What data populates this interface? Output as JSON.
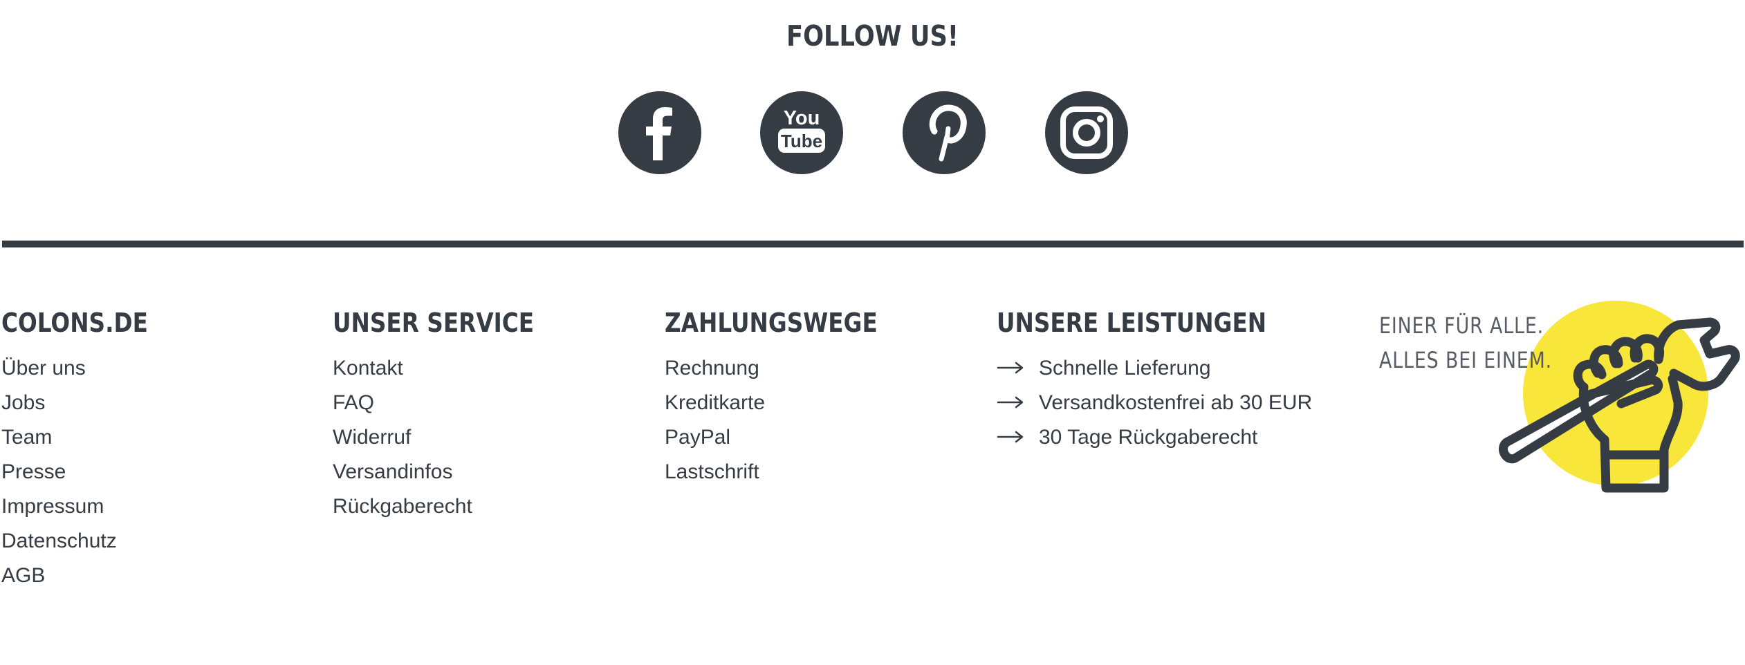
{
  "follow": {
    "title": "FOLLOW US!"
  },
  "social": [
    {
      "name": "Facebook",
      "icon": "facebook-icon"
    },
    {
      "name": "YouTube",
      "icon": "youtube-icon",
      "logo_text_top": "You",
      "logo_text_bottom": "Tube"
    },
    {
      "name": "Pinterest",
      "icon": "pinterest-icon"
    },
    {
      "name": "Instagram",
      "icon": "instagram-icon"
    }
  ],
  "footer": {
    "columns": [
      {
        "heading": "COLONS.DE",
        "items": [
          "Über uns",
          "Jobs",
          "Team",
          "Presse",
          "Impressum",
          "Datenschutz",
          "AGB"
        ]
      },
      {
        "heading": "UNSER SERVICE",
        "items": [
          "Kontakt",
          "FAQ",
          "Widerruf",
          "Versandinfos",
          "Rückgaberecht"
        ]
      },
      {
        "heading": "ZAHLUNGSWEGE",
        "items": [
          "Rechnung",
          "Kreditkarte",
          "PayPal",
          "Lastschrift"
        ]
      },
      {
        "heading": "UNSERE LEISTUNGEN",
        "items": [
          "Schnelle Lieferung",
          "Versandkostenfrei ab 30 EUR",
          "30 Tage Rückgaberecht"
        ],
        "bullet_icon": "arrow-right-icon"
      }
    ],
    "slogan": {
      "line1": "EINER FÜR ALLE.",
      "line2": "ALLES BEI EINEM."
    },
    "illustration": {
      "icon": "fist-wrench-icon"
    }
  },
  "colors": {
    "dark": "#353c44",
    "accent_yellow": "#f8e73a",
    "background": "#ffffff"
  }
}
